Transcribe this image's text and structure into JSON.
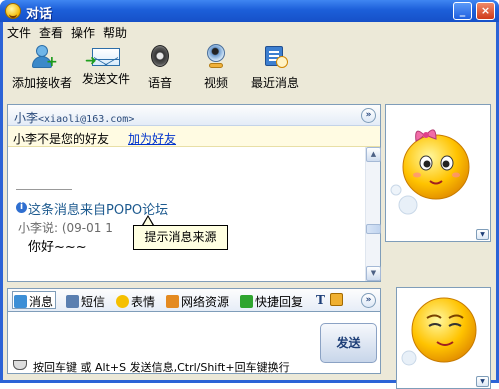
{
  "window": {
    "title": "对话",
    "controls": {
      "minimize": "_",
      "close": "×"
    }
  },
  "menu": [
    "文件",
    "查看",
    "操作",
    "帮助"
  ],
  "toolbar": [
    {
      "label": "添加接收者",
      "icon": "add-contact-icon"
    },
    {
      "label": "发送文件",
      "icon": "send-file-icon"
    },
    {
      "label": "语音",
      "icon": "speaker-icon"
    },
    {
      "label": "视频",
      "icon": "webcam-icon"
    },
    {
      "label": "最近消息",
      "icon": "recent-messages-icon"
    }
  ],
  "chat": {
    "contact_name": "小李",
    "contact_email": "<xiaoli@163.com>",
    "expand": "»",
    "notice": "小李不是您的好友",
    "add_friend": "加为好友",
    "message": {
      "info": "这条消息来自POPO论坛",
      "sender_line": "小李说: (09-01 1",
      "body": "你好~~~"
    },
    "tooltip": "提示消息来源"
  },
  "input_toolbar": {
    "items": [
      "消息",
      "短信",
      "表情",
      "网络资源",
      "快捷回复"
    ],
    "font_icon": "T",
    "expand": "»"
  },
  "send_button": "发送",
  "status": "按回车键 或 Alt+S 发送信息,Ctrl/Shift+回车键换行",
  "colors": {
    "titlebar": "#1c5fd9",
    "link": "#0033cc",
    "info_text": "#1d5a8f"
  }
}
